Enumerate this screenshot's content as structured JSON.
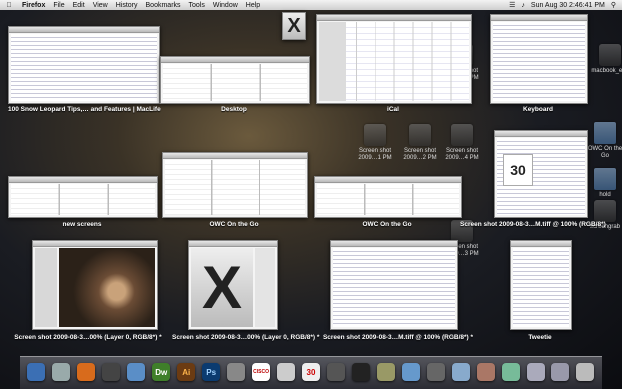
{
  "menubar": {
    "app": "Firefox",
    "items": [
      "File",
      "Edit",
      "View",
      "History",
      "Bookmarks",
      "Tools",
      "Window",
      "Help"
    ],
    "clock": "Sun Aug 30  2:46:41 PM"
  },
  "windows": {
    "w1": "100 Snow Leopard Tips,… and Features | MacLife",
    "w2": "Desktop",
    "w3": "iCal",
    "w4": "Keyboard",
    "w5": "new screens",
    "w6": "OWC On the Go",
    "w7": "OWC On the Go",
    "w8": "Screen shot 2009-08-3…M.tiff @ 100% (RGB/8*)",
    "w9": "Screen shot 2009-08-3…00% (Layer 0, RGB/8*) *",
    "w10": "Screen shot 2009-08-3…00% (Layer 0, RGB/8*) *",
    "w11": "Screen shot 2009-08-3…M.tiff @ 100% (RGB/8*) *",
    "w12": "Tweetie"
  },
  "desktop_icons": [
    {
      "label": "Screen shot 2009…4 PM"
    },
    {
      "label": "Screen shot 2009…4 PM"
    },
    {
      "label": "Screen shot 2009…1 PM"
    },
    {
      "label": "OWC On the Go"
    },
    {
      "label": "Screen shot 2009…2 PM"
    },
    {
      "label": "Screen shot 2009…3 PM"
    },
    {
      "label": "macbook_edit"
    },
    {
      "label": "hold"
    },
    {
      "label": "screengrab"
    }
  ],
  "dock": {
    "dw": "Dw",
    "ai": "Ai",
    "ps": "Ps",
    "cal_day": "30",
    "cisco": "CISCO"
  }
}
